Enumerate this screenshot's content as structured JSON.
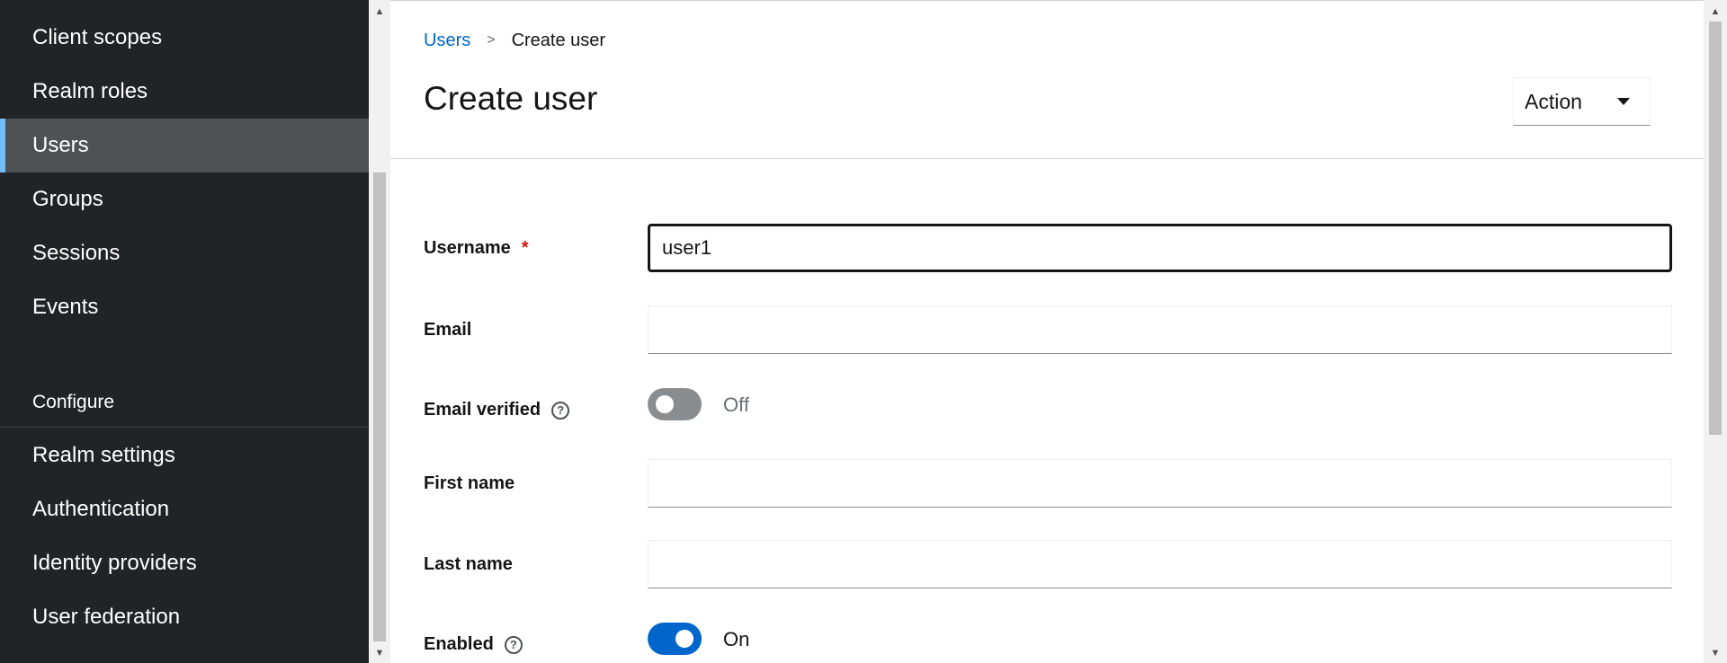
{
  "sidebar": {
    "items": [
      {
        "label": "Client scopes"
      },
      {
        "label": "Realm roles"
      },
      {
        "label": "Users",
        "active": true
      },
      {
        "label": "Groups"
      },
      {
        "label": "Sessions"
      },
      {
        "label": "Events"
      }
    ],
    "section_configure": "Configure",
    "configure_items": [
      {
        "label": "Realm settings"
      },
      {
        "label": "Authentication"
      },
      {
        "label": "Identity providers"
      },
      {
        "label": "User federation"
      }
    ]
  },
  "breadcrumb": {
    "parent": "Users",
    "separator": ">",
    "current": "Create user"
  },
  "page": {
    "title": "Create user",
    "action_label": "Action"
  },
  "form": {
    "username": {
      "label": "Username",
      "required_mark": "*",
      "value": "user1"
    },
    "email": {
      "label": "Email",
      "value": ""
    },
    "email_verified": {
      "label": "Email verified",
      "help": "?",
      "state": "Off"
    },
    "first_name": {
      "label": "First name",
      "value": ""
    },
    "last_name": {
      "label": "Last name",
      "value": ""
    },
    "enabled": {
      "label": "Enabled",
      "help": "?",
      "state": "On"
    }
  },
  "colors": {
    "sidebar_bg": "#212427",
    "active_item_bg": "#4f5255",
    "active_indicator": "#73bcf7",
    "link": "#0066cc",
    "toggle_on": "#0066cc",
    "toggle_off": "#8a8d90",
    "required": "#c9190b"
  }
}
